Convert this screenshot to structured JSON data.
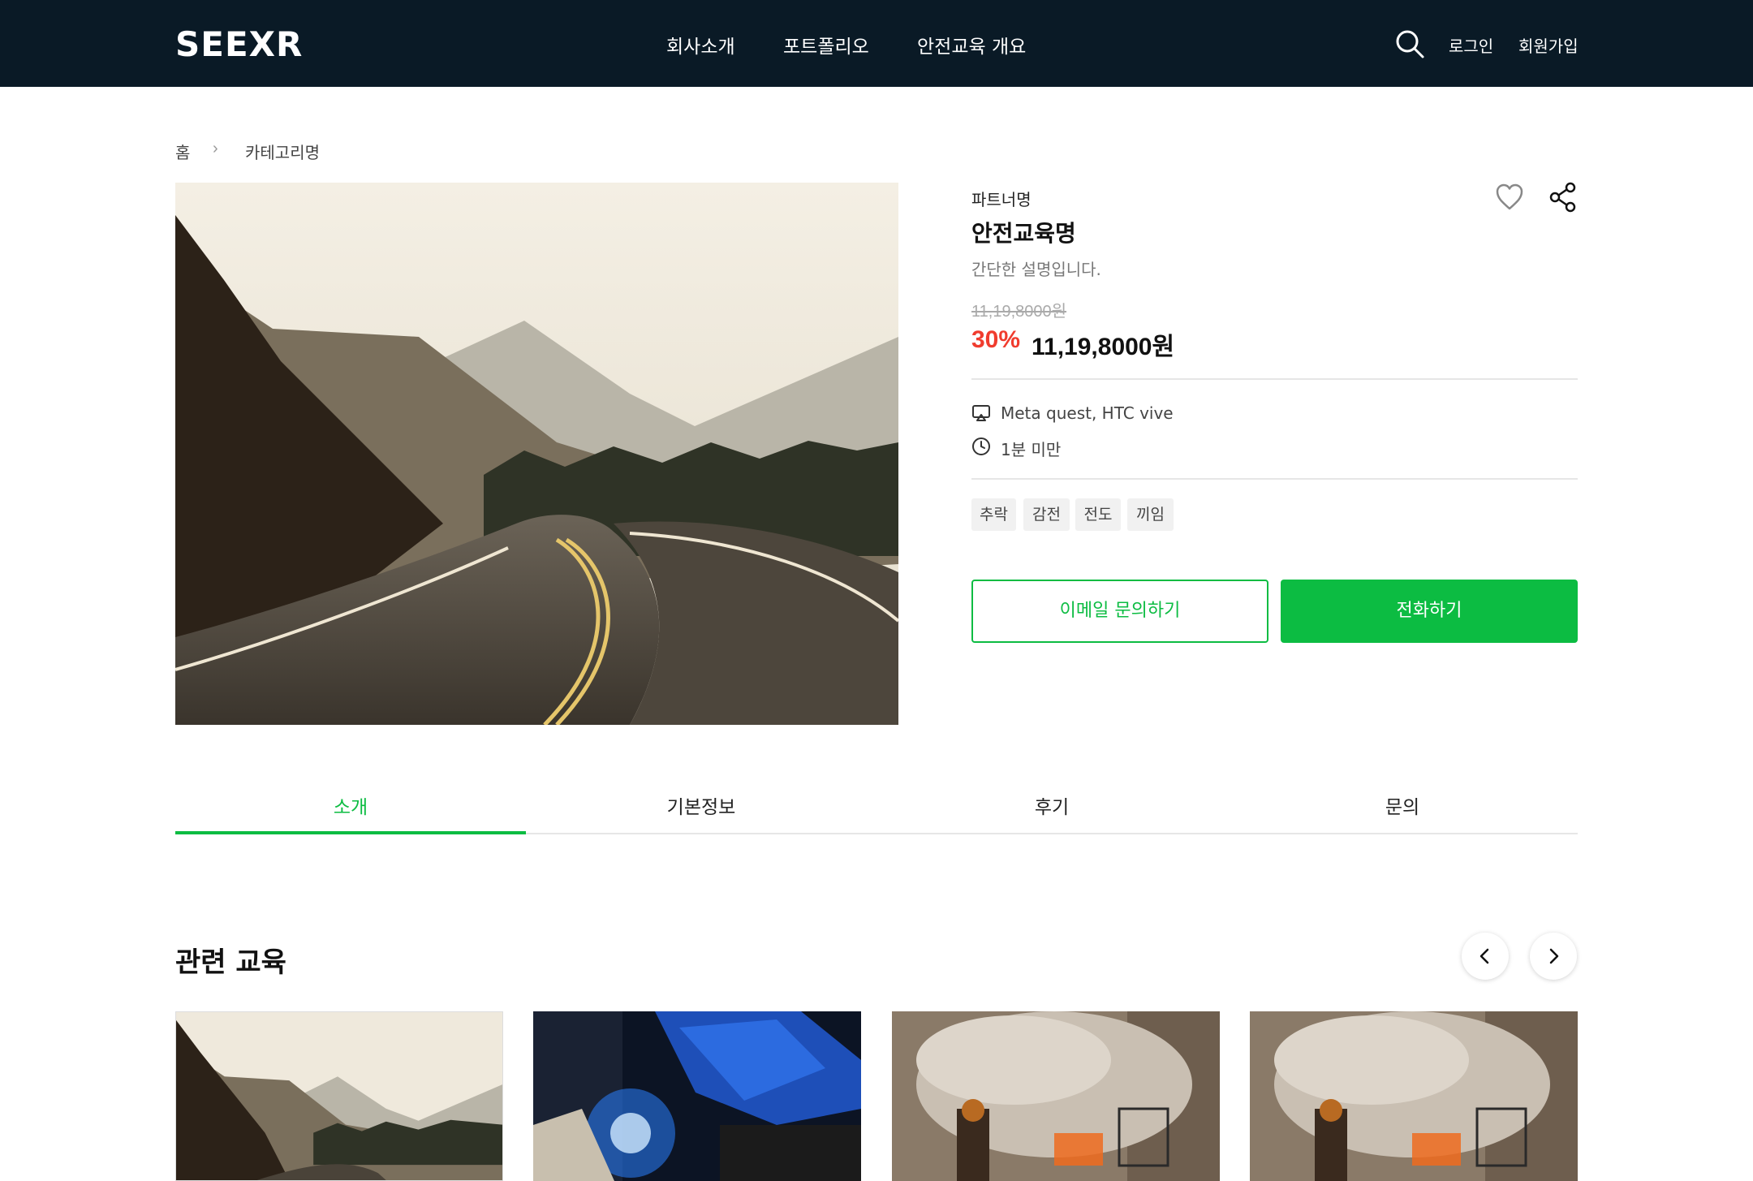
{
  "header": {
    "logo": "SEEXR",
    "nav": [
      "회사소개",
      "포트폴리오",
      "안전교육 개요"
    ],
    "login": "로그인",
    "signup": "회원가입"
  },
  "breadcrumb": {
    "home": "홈",
    "separator": "›",
    "category": "카테고리명"
  },
  "product": {
    "partner": "파트너명",
    "title": "안전교육명",
    "description": "간단한 설명입니다.",
    "original_price": "11,19,8000원",
    "discount": "30%",
    "price": "11,19,8000원",
    "devices": "Meta quest, HTC vive",
    "duration": "1분 미만",
    "tags": [
      "추락",
      "감전",
      "전도",
      "끼임"
    ],
    "email_button": "이메일 문의하기",
    "call_button": "전화하기"
  },
  "tabs": [
    "소개",
    "기본정보",
    "후기",
    "문의"
  ],
  "related": {
    "title": "관련 교육"
  },
  "colors": {
    "header_bg": "#0a1a26",
    "accent_green": "#0cbc42",
    "discount_red": "#f03c2e"
  }
}
